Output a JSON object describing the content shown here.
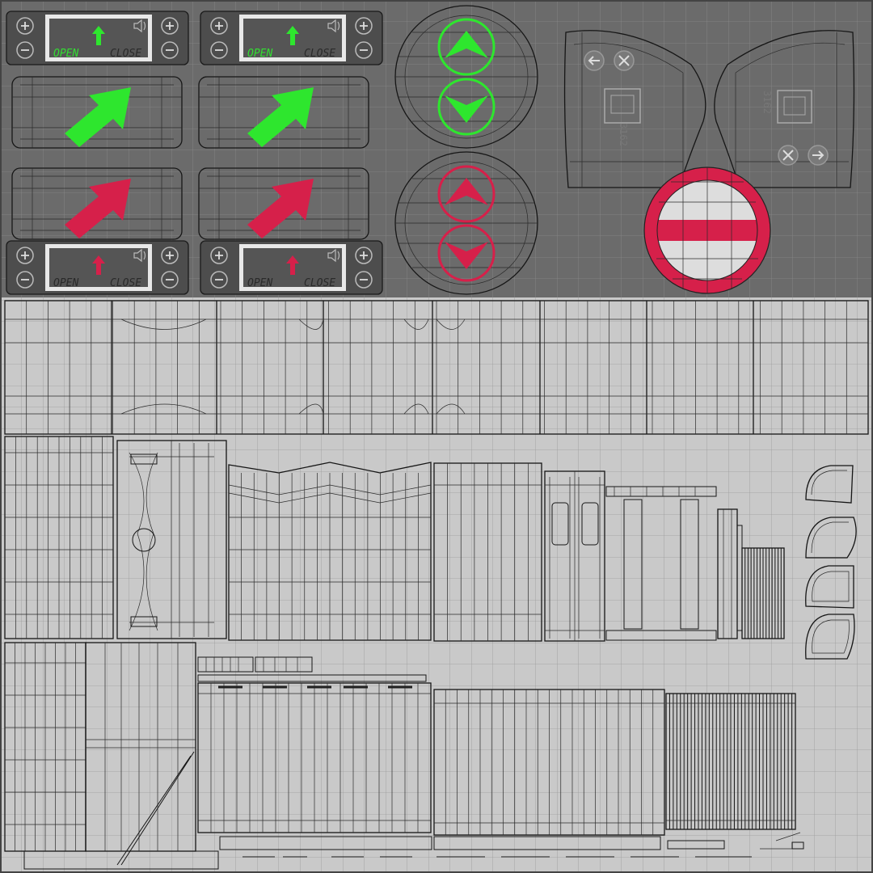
{
  "colors": {
    "bg_top": "#6b6b6b",
    "bg_bottom": "#c9c9c9",
    "accent_green": "#2ee62e",
    "accent_red": "#d6204a",
    "panel_screen": "#505050",
    "grid_line": "#9a9a9a"
  },
  "panels": [
    {
      "open": "OPEN",
      "close": "CLOSE",
      "indicator": "green"
    },
    {
      "open": "OPEN",
      "close": "CLOSE",
      "indicator": "green"
    },
    {
      "open": "OPEN",
      "close": "CLOSE",
      "indicator": "red"
    },
    {
      "open": "OPEN",
      "close": "CLOSE",
      "indicator": "red"
    }
  ],
  "door_labels": {
    "left": "3162",
    "right": "3162"
  },
  "icons": {
    "plus": "plus-icon",
    "minus": "minus-icon",
    "sound": "sound-icon",
    "arrow_up": "arrow-up-icon",
    "arrow_down": "arrow-down-icon",
    "back": "back-arrow-icon",
    "close": "close-x-icon",
    "no_entry": "no-entry-sign-icon"
  }
}
